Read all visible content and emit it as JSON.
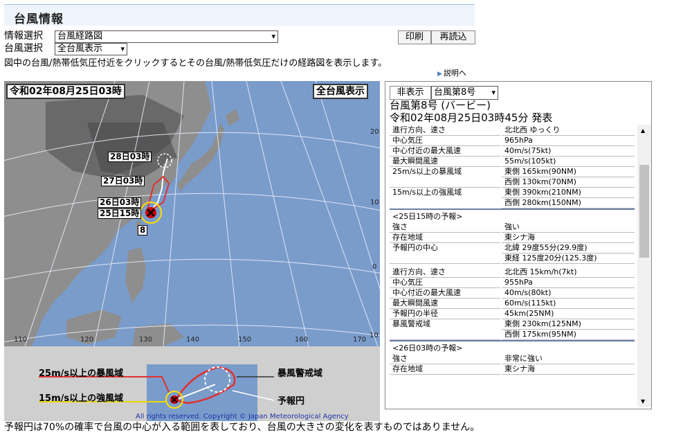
{
  "header": {
    "title": "台風情報"
  },
  "controls": {
    "info_label": "情報選択",
    "info_value": "台風経路図",
    "typhoon_label": "台風選択",
    "typhoon_value": "全台風表示",
    "print": "印刷",
    "reload": "再読込"
  },
  "description": "図中の台風/熱帯低気圧付近をクリックするとその台風/熱帯低気圧だけの経路図を表示します。",
  "help_link": "説明へ",
  "map": {
    "date_label": "令和02年08月25日03時",
    "mode_label": "全台風表示",
    "day_labels": [
      "28日03時",
      "27日03時",
      "26日03時",
      "25日15時"
    ],
    "typhoon_number": "8",
    "lat_ticks": [
      "20",
      "10",
      "0",
      "10"
    ],
    "lon_ticks": [
      "110",
      "120",
      "130",
      "140",
      "150",
      "160",
      "170"
    ],
    "copyright": "All rights reserved. Copyright © Japan Meteorological Agency"
  },
  "legend": {
    "storm_area": "25m/s以上の暴風域",
    "strong_area": "15m/s以上の強風域",
    "warning_area": "暴風警戒域",
    "forecast_circle": "予報円"
  },
  "panel": {
    "hide_button": "非表示",
    "select_value": "台風第8号",
    "title": "台風第8号 (バービー)",
    "issued": "令和02年08月25日03時45分 発表",
    "rows": [
      {
        "k": "進行方向、速さ",
        "v": "北北西 ゆっくり"
      },
      {
        "k": "中心気圧",
        "v": "965hPa"
      },
      {
        "k": "中心付近の最大風速",
        "v": "40m/s(75kt)"
      },
      {
        "k": "最大瞬間風速",
        "v": "55m/s(105kt)"
      },
      {
        "k": "25m/s以上の暴風域",
        "v": "東側 165km(90NM)"
      },
      {
        "k": "",
        "v": "西側 130km(70NM)"
      },
      {
        "k": "15m/s以上の強風域",
        "v": "東側 390km(210NM)"
      },
      {
        "k": "",
        "v": "西側 280km(150NM)"
      },
      {
        "k": "<25日15時の予報>",
        "v": ""
      },
      {
        "k": "強さ",
        "v": "強い"
      },
      {
        "k": "存在地域",
        "v": "東シナ海"
      },
      {
        "k": "予報円の中心",
        "v": "北緯 29度55分(29.9度)"
      },
      {
        "k": "",
        "v": "東経 125度20分(125.3度)"
      },
      {
        "k": "進行方向、速さ",
        "v": "北北西 15km/h(7kt)"
      },
      {
        "k": "中心気圧",
        "v": "955hPa"
      },
      {
        "k": "中心付近の最大風速",
        "v": "40m/s(80kt)"
      },
      {
        "k": "最大瞬間風速",
        "v": "60m/s(115kt)"
      },
      {
        "k": "予報円の半径",
        "v": "45km(25NM)"
      },
      {
        "k": "暴風警戒域",
        "v": "東側 230km(125NM)"
      },
      {
        "k": "",
        "v": "西側 175km(95NM)"
      },
      {
        "k": "<26日03時の予報>",
        "v": ""
      },
      {
        "k": "強さ",
        "v": "非常に強い"
      },
      {
        "k": "存在地域",
        "v": "東シナ海"
      }
    ]
  },
  "footnote": "予報円は70%の確率で台風の中心が入る範囲を表しており、台風の大きさの変化を表すものではありません。"
}
